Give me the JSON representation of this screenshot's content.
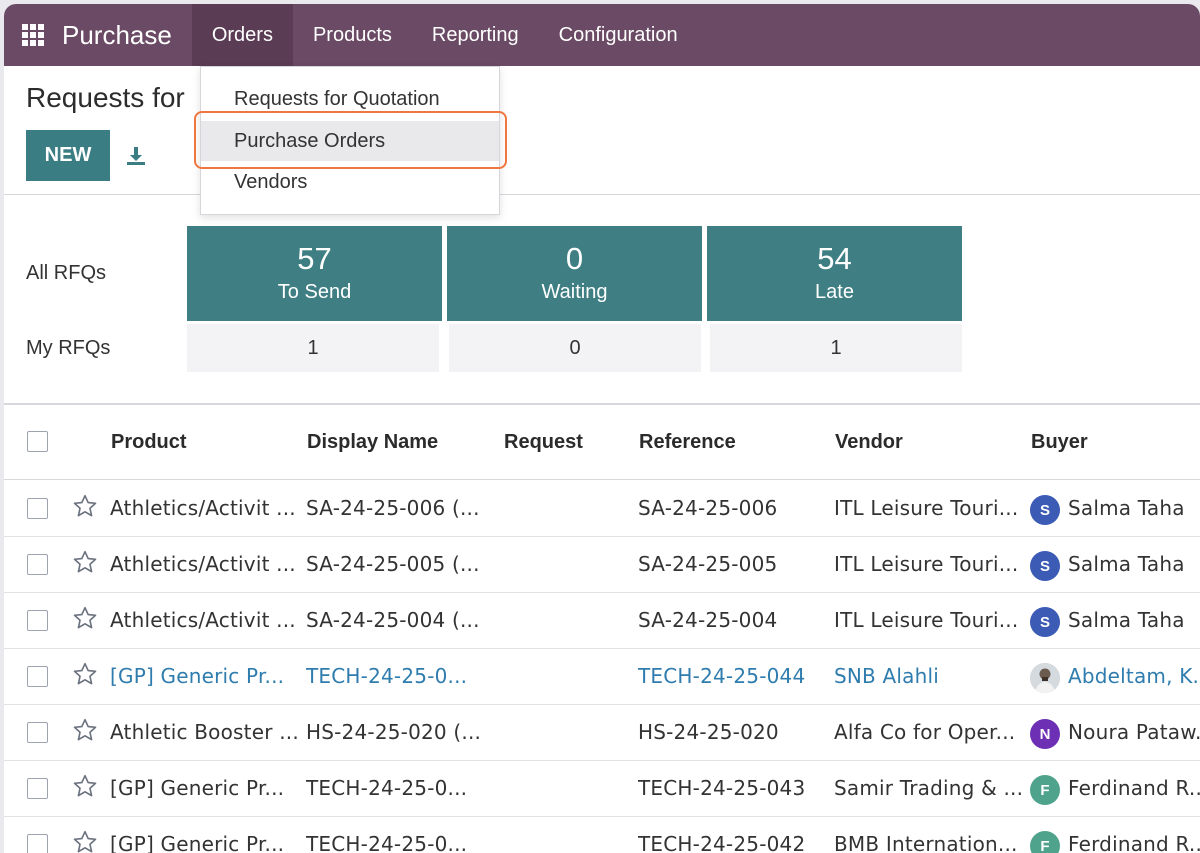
{
  "navbar": {
    "app_name": "Purchase",
    "menu": [
      "Orders",
      "Products",
      "Reporting",
      "Configuration"
    ],
    "bg_color": "#6a4a64",
    "active_color": "#5a3c54"
  },
  "dropdown": {
    "items": [
      "Requests for Quotation",
      "Purchase Orders",
      "Vendors"
    ],
    "highlight_color": "#f0763f"
  },
  "page": {
    "title": "Requests for",
    "new_label": "NEW",
    "download_icon": "download-icon"
  },
  "dashboard": {
    "all_label": "All RFQs",
    "my_label": "My RFQs",
    "tiles": [
      {
        "value": "57",
        "label": "To Send",
        "mine": "1"
      },
      {
        "value": "0",
        "label": "Waiting",
        "mine": "0"
      },
      {
        "value": "54",
        "label": "Late",
        "mine": "1"
      }
    ],
    "tile_color": "#3f7f84"
  },
  "table": {
    "columns": [
      "Product",
      "Display Name",
      "Request",
      "Reference",
      "Vendor",
      "Buyer"
    ],
    "rows": [
      {
        "product": "Athletics/Activit ...",
        "display_name": "SA-24-25-006 (...",
        "request": "",
        "reference": "SA-24-25-006",
        "vendor": "ITL Leisure Touri...",
        "buyer_initial": "S",
        "buyer": "Salma Taha",
        "avatar_color": "#3b5bb5",
        "link": false
      },
      {
        "product": "Athletics/Activit ...",
        "display_name": "SA-24-25-005 (...",
        "request": "",
        "reference": "SA-24-25-005",
        "vendor": "ITL Leisure Touri...",
        "buyer_initial": "S",
        "buyer": "Salma Taha",
        "avatar_color": "#3b5bb5",
        "link": false
      },
      {
        "product": "Athletics/Activit ...",
        "display_name": "SA-24-25-004 (...",
        "request": "",
        "reference": "SA-24-25-004",
        "vendor": "ITL Leisure Touri...",
        "buyer_initial": "S",
        "buyer": "Salma Taha",
        "avatar_color": "#3b5bb5",
        "link": false
      },
      {
        "product": "[GP] Generic Pr...",
        "display_name": "TECH-24-25-0...",
        "request": "",
        "reference": "TECH-24-25-044",
        "vendor": "SNB Alahli",
        "buyer_initial": "",
        "buyer": "Abdeltam, K.",
        "avatar_color": "photo",
        "link": true
      },
      {
        "product": "Athletic Booster ...",
        "display_name": "HS-24-25-020 (...",
        "request": "",
        "reference": "HS-24-25-020",
        "vendor": "Alfa Co for Oper...",
        "buyer_initial": "N",
        "buyer": "Noura Pataw...",
        "avatar_color": "#6d2fb3",
        "link": false
      },
      {
        "product": "[GP] Generic Pr...",
        "display_name": "TECH-24-25-0...",
        "request": "",
        "reference": "TECH-24-25-043",
        "vendor": "Samir Trading & ...",
        "buyer_initial": "F",
        "buyer": "Ferdinand R...",
        "avatar_color": "#4fa38c",
        "link": false
      },
      {
        "product": "[GP] Generic Pr...",
        "display_name": "TECH-24-25-0...",
        "request": "",
        "reference": "TECH-24-25-042",
        "vendor": "BMB Internation...",
        "buyer_initial": "F",
        "buyer": "Ferdinand R...",
        "avatar_color": "#4fa38c",
        "link": false
      }
    ],
    "link_color": "#2f7cae"
  }
}
